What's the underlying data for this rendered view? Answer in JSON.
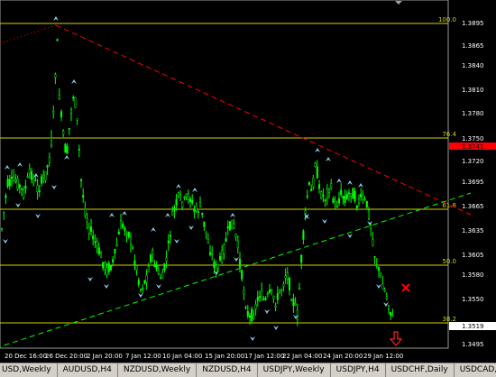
{
  "price_axis": {
    "labels": [
      "1.3895",
      "1.3865",
      "1.3840",
      "1.3810",
      "1.3780",
      "1.3750",
      "1.3720",
      "1.3695",
      "1.3665",
      "1.3635",
      "1.3605",
      "1.3580",
      "1.3550",
      "1.3520",
      "1.3495"
    ],
    "current_price": "1.3741",
    "bid_price": "1.3519"
  },
  "time_axis": {
    "labels": [
      "20 Dec 16:00",
      "26 Dec 20:00",
      "2 Jan 20:00",
      "7 Jan 12:00",
      "10 Jan 04:00",
      "15 Jan 20:00",
      "17 Jan 12:00",
      "22 Jan 04:00",
      "24 Jan 20:00",
      "29 Jan 12:00"
    ]
  },
  "fibonacci": {
    "levels": [
      "100.0",
      "76.4",
      "61.8",
      "50.0",
      "38.2"
    ]
  },
  "tabs": [
    "USD,Weekly",
    "AUDUSD,H4",
    "NZDUSD,Weekly",
    "NZDUSD,H4",
    "USDJPY,Weekly",
    "USDJPY,H4",
    "USDCHF,Daily",
    "USDCAD,Week"
  ],
  "colors": {
    "background": "#000000",
    "candles": "#00ff00",
    "fractal_arrows": "#87ceeb",
    "fib_levels": "#d4d400",
    "downtrend_line": "#ff0000",
    "uptrend_line": "#00ff00",
    "current_price_box": "#ff0000",
    "sell_signal": "#ff0000"
  }
}
